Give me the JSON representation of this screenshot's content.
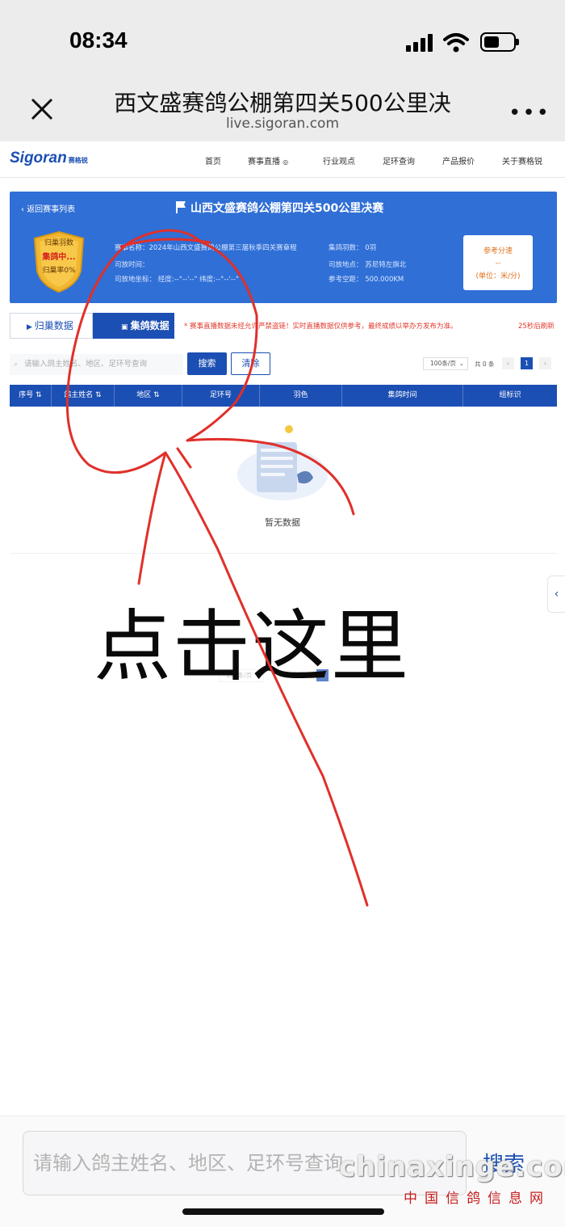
{
  "status_bar": {
    "time": "08:34"
  },
  "browser": {
    "title": "西文盛赛鸽公棚第四关500公里决",
    "url": "live.sigoran.com"
  },
  "site_nav": {
    "logo": "Sigoran",
    "logo_sub": "赛格锐",
    "items": [
      "首页",
      "赛事直播",
      "行业观点",
      "足环查询",
      "产品报价",
      "关于赛格锐"
    ]
  },
  "race": {
    "back_label": "返回赛事列表",
    "title": "山西文盛赛鸽公棚第四关500公里决赛",
    "shield": {
      "top": "归巢羽数",
      "middle": "集鸽中...",
      "bottom": "归巢率0%"
    },
    "info": {
      "name": "赛事名称：2024年山西文盛赛鸽公棚第三届秋季四关赛章程",
      "release_time": "司放时间：",
      "release_coords": "司放地坐标：  经度:--°--'--\"    纬度:--°--'--\"",
      "collect_count": "集鸽羽数：   0羽",
      "release_place": "司放地点：   苏尼特左旗北",
      "reference_distance": "参考空距：   500.000KM"
    },
    "speed": {
      "label": "参考分速",
      "value": "--",
      "unit": "(单位：米/分)"
    }
  },
  "tabs": {
    "return": "归巢数据",
    "collect": "集鸽数据"
  },
  "notice": "* 赛事直播数据未经允许严禁盗链！实时直播数据仅供参考，最终成绩以举办方发布为准。",
  "refresh": "25秒后刷新",
  "search": {
    "placeholder": "请输入鸽主姓名、地区、足环号查询",
    "button": "搜索",
    "clear": "清除"
  },
  "pager": {
    "page_size": "100条/页",
    "total": "共 0 条",
    "page": "1"
  },
  "table": {
    "columns": [
      "序号",
      "鸽主姓名",
      "地区",
      "足环号",
      "羽色",
      "集鸽时间",
      "组标识"
    ]
  },
  "empty_text": "暂无数据",
  "annotation": {
    "text": "点击这里",
    "color": "#e0302a"
  },
  "bottom": {
    "placeholder": "请输入鸽主姓名、地区、足环号查询",
    "search": "搜索",
    "watermark": "chinaxinge.com",
    "watermark_sub": "中国信鸽信息网"
  },
  "colors": {
    "primary": "#1c4fb3",
    "banner": "#2f6fd6",
    "alert": "#e0382b"
  }
}
